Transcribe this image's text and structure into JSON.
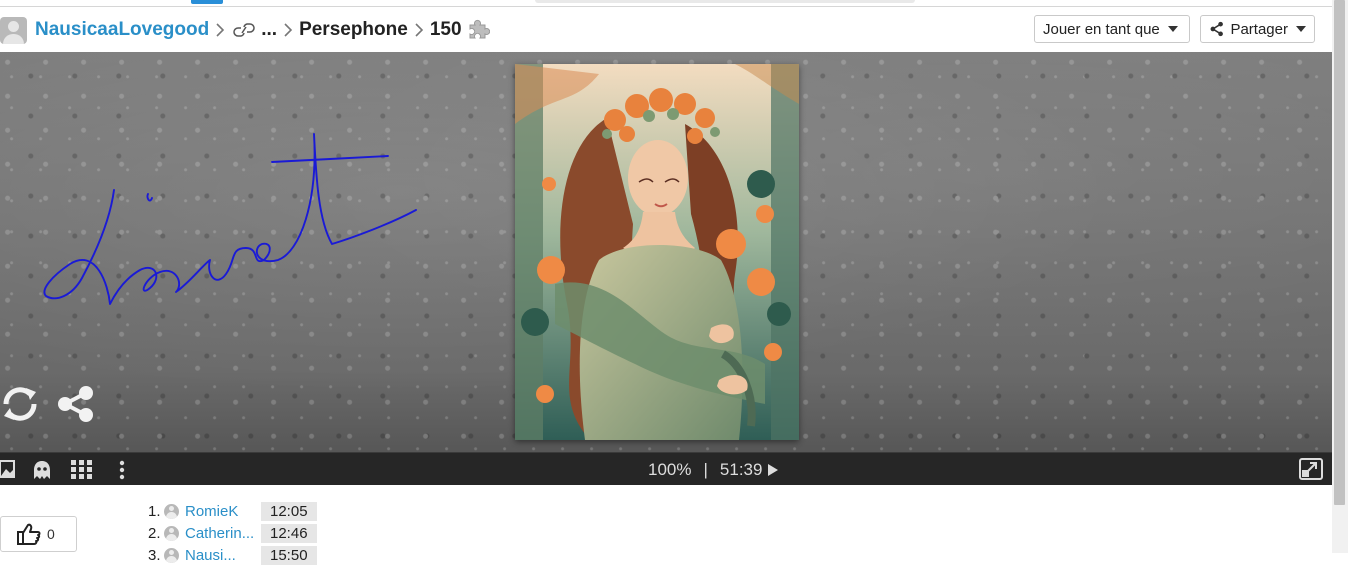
{
  "breadcrumb": {
    "user": "NausicaaLovegood",
    "ellipsis": "...",
    "puzzle_title": "Persephone",
    "piece_count": "150"
  },
  "header_buttons": {
    "play_as_label": "Jouer en tant que",
    "share_label": "Partager"
  },
  "icons": {
    "header": [
      "user-avatar-icon",
      "chevron-right-icon",
      "link-icon",
      "puzzle-piece-icon",
      "share-icon",
      "caret-down-icon"
    ],
    "stage": [
      "refresh-icon",
      "share-icon"
    ],
    "toolbar": [
      "image-icon",
      "ghost-icon",
      "grid-icon",
      "more-vertical-icon",
      "play-icon",
      "fullscreen-icon"
    ],
    "like": "thumbs-up-icon"
  },
  "toolbar": {
    "zoom": "100%",
    "divider": "|",
    "timer": "51:39"
  },
  "likes": {
    "count": "0"
  },
  "leaderboard": [
    {
      "rank": "1.",
      "name": "RomieK",
      "time": "12:05"
    },
    {
      "rank": "2.",
      "name": "Catherin...",
      "time": "12:46"
    },
    {
      "rank": "3.",
      "name": "Nausi...",
      "time": "15:50"
    }
  ],
  "colors": {
    "link": "#2a8fc8",
    "scribble": "#1a1ad6",
    "toolbar_bg": "#262626",
    "stage_bg": "#6f6f6f"
  }
}
